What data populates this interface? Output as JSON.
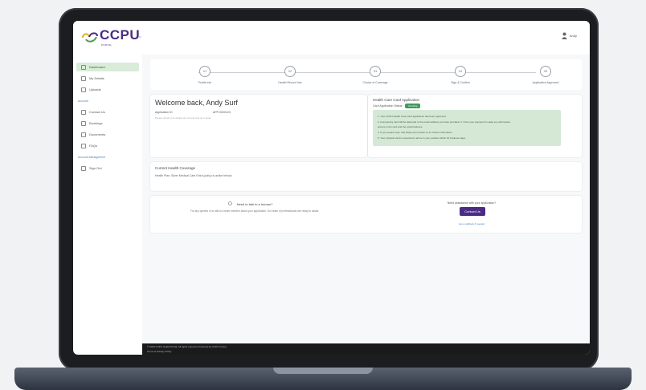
{
  "brand": {
    "name": "CCPU",
    "tagline": "PORTAL"
  },
  "user_menu": {
    "label": "Andy"
  },
  "sidebar": {
    "items": [
      {
        "label": "Dashboard",
        "active": true
      },
      {
        "label": "My Details",
        "active": false
      },
      {
        "label": "Uploads",
        "active": false
      }
    ],
    "section1": "Account",
    "items2": [
      {
        "label": "Contact Us"
      },
      {
        "label": "Bookings"
      },
      {
        "label": "Documents"
      },
      {
        "label": "FAQs"
      }
    ],
    "section2": "Account Management",
    "items3": [
      {
        "label": "Sign Out"
      }
    ]
  },
  "stepper": {
    "steps": [
      {
        "num": "01",
        "label": "Profile Info"
      },
      {
        "num": "02",
        "label": "Health Record Info"
      },
      {
        "num": "03",
        "label": "Choice of Coverage"
      },
      {
        "num": "04",
        "label": "Sign & Confirm"
      },
      {
        "num": "05",
        "label": "Application Approved"
      }
    ]
  },
  "welcome": {
    "title": "Welcome back, Andy Surf",
    "app_no_label": "Application ID",
    "app_no_value": "APP-0000123",
    "note": "Please check your details are correct and up to date"
  },
  "application": {
    "title": "Health Care Card Application",
    "status_label": "Card Application Status:",
    "status_value": "Pending",
    "info_lines": [
      "1. Your CCPU Health Care Card application has been approved.",
      "2. A temporary card will be delivered to the email address you have provided. 3. Once your payment is made you will receive",
      "   access to the card and the portal features.",
      "4. If you require help, visit FAQs and contact us for further information.",
      "5. Your physical card is expected to arrive in your postbox within 10 business days."
    ]
  },
  "coverage": {
    "title": "Current Health Coverage",
    "text": "Health Plan: Silver Medical Care Extra (policy is active below)"
  },
  "help": {
    "title": "Need to talk to a human?",
    "text": "For any queries or to talk to a team member about your application. Our team of professionals are ready to assist.",
    "question": "Need assistance with your application?",
    "button": "Contact Us",
    "link": "Get a callback if needed"
  },
  "footer": {
    "line1": "© 2024 CCPU Health Portal. All rights reserved. Powered by CCPU Group.",
    "line2": "Terms & Privacy Policy"
  },
  "colors": {
    "brand_purple": "#4a2c84",
    "active_green": "#d9ecd9",
    "info_green": "#d5e8d6",
    "badge_green": "#3f9b5b"
  }
}
